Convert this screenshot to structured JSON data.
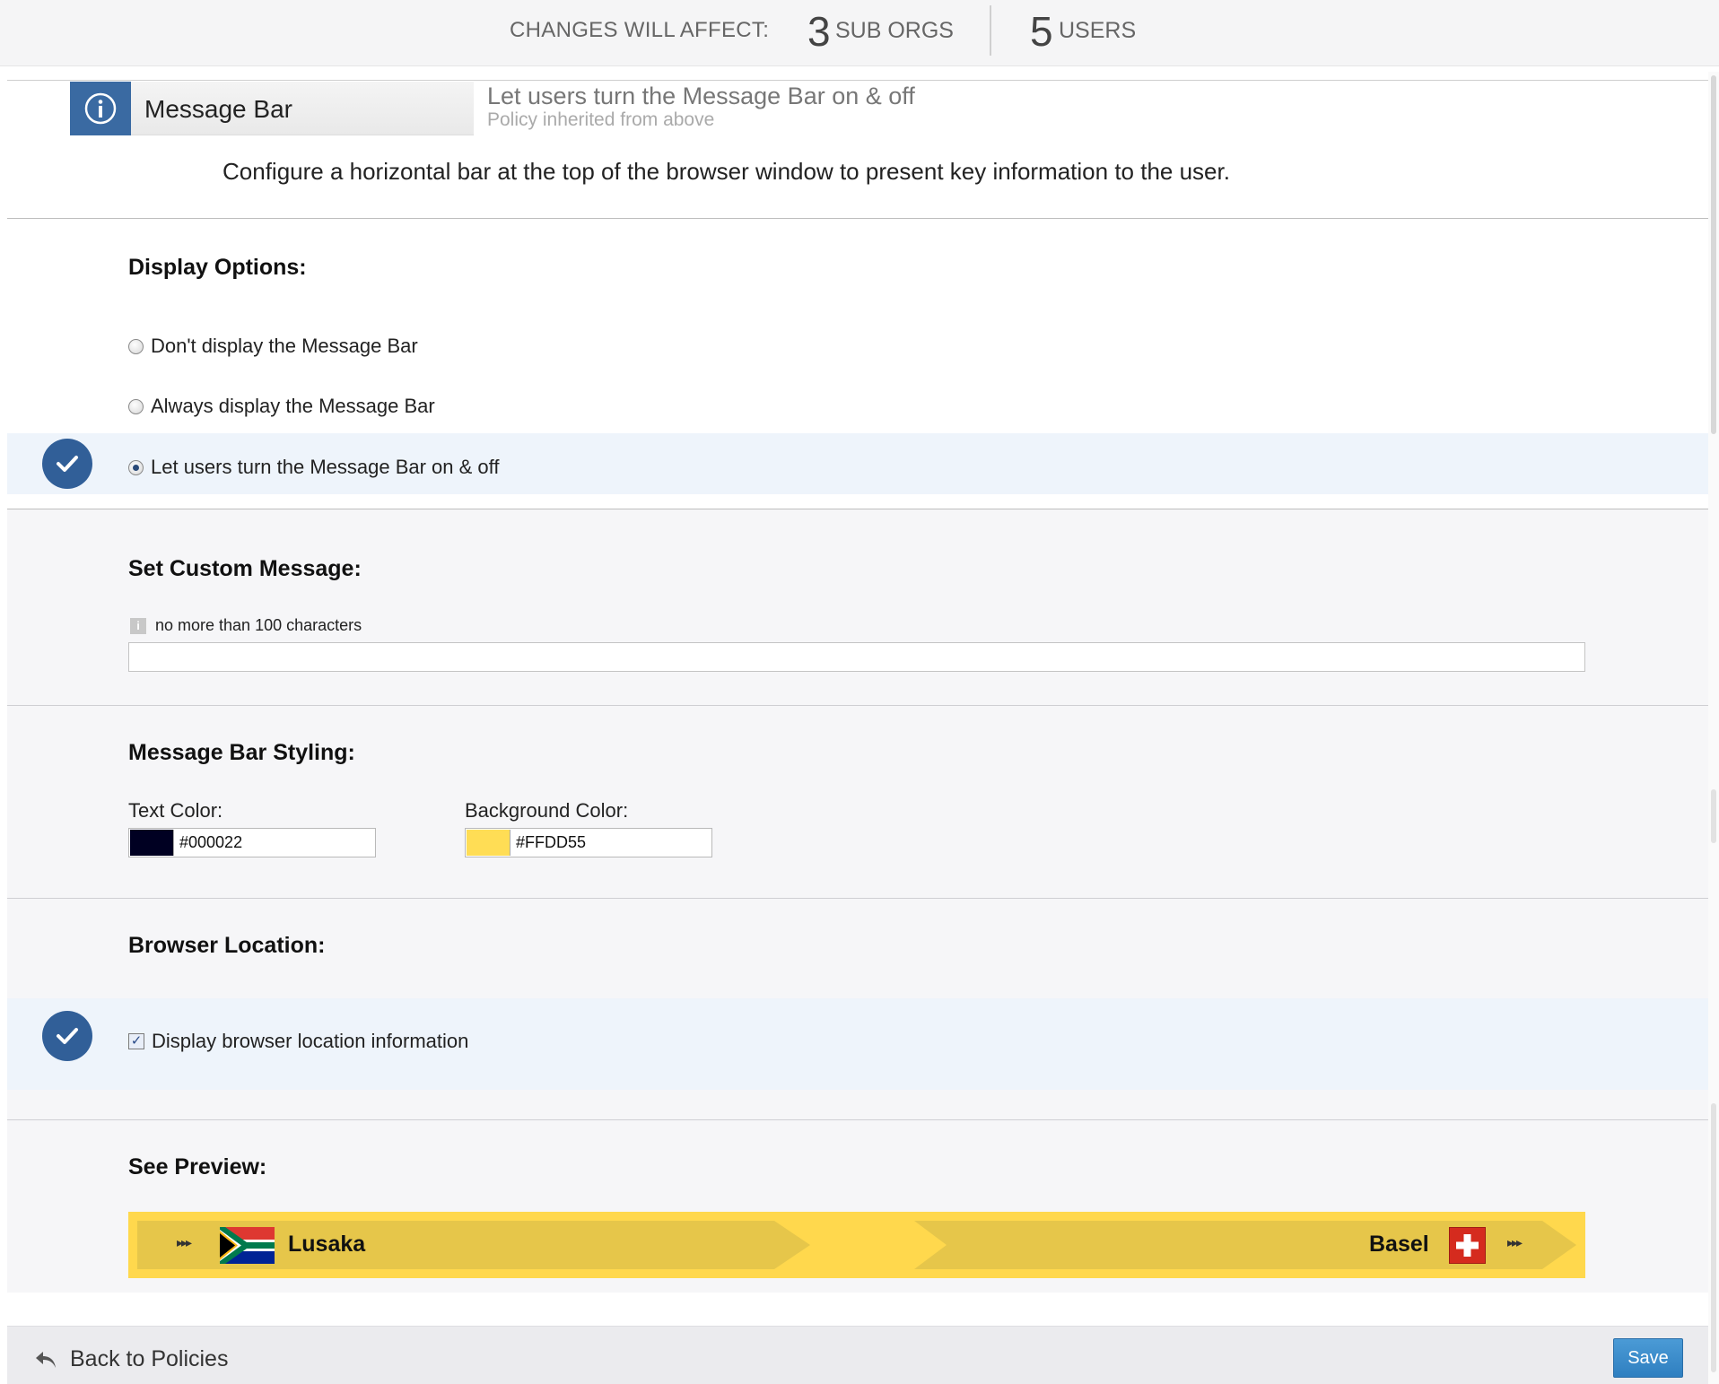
{
  "summary": {
    "label": "CHANGES WILL AFFECT:",
    "sub_orgs_count": "3",
    "sub_orgs_label": "SUB ORGS",
    "users_count": "5",
    "users_label": "USERS"
  },
  "policy": {
    "name": "Message Bar",
    "state": "Let users turn the Message Bar on & off",
    "inheritance": "Policy inherited from above",
    "description": "Configure a horizontal bar at the top of the browser window to present key information to the user."
  },
  "display_options": {
    "title": "Display Options:",
    "options": [
      {
        "label": "Don't display the Message Bar",
        "selected": false
      },
      {
        "label": "Always display the Message Bar",
        "selected": false
      },
      {
        "label": "Let users turn the Message Bar on & off",
        "selected": true
      }
    ]
  },
  "custom_message": {
    "title": "Set Custom Message:",
    "hint": "no more than 100 characters",
    "value": ""
  },
  "styling": {
    "title": "Message Bar Styling:",
    "text_color_label": "Text Color:",
    "text_color": "#000022",
    "background_color_label": "Background Color:",
    "background_color": "#FFDD55"
  },
  "browser_location": {
    "title": "Browser Location:",
    "checkbox_label": "Display browser location information",
    "checked": true
  },
  "preview": {
    "title": "See Preview:",
    "left_city": "Lusaka",
    "right_city": "Basel",
    "arrows": "▸▸▸"
  },
  "footer": {
    "back_label": "Back to Policies",
    "save_label": "Save"
  },
  "colors": {
    "accent": "#315f98",
    "save_button": "#3a8ccb",
    "selected_band": "#eef4fb"
  }
}
